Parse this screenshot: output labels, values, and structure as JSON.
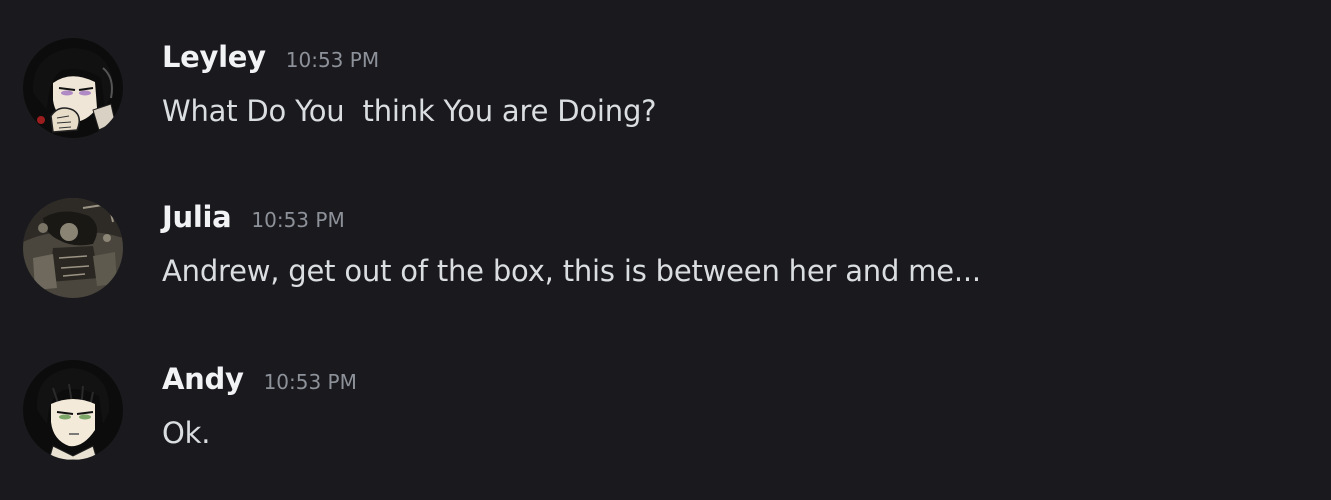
{
  "messages": [
    {
      "username": "Leyley",
      "timestamp": "10:53 PM",
      "content": "What Do You  think You are Doing?",
      "avatar": "leyley-avatar"
    },
    {
      "username": "Julia",
      "timestamp": "10:53 PM",
      "content": "Andrew, get out of the box, this is between her and me...",
      "avatar": "julia-avatar"
    },
    {
      "username": "Andy",
      "timestamp": "10:53 PM",
      "content": "Ok.",
      "avatar": "andy-avatar"
    }
  ],
  "colors": {
    "background": "#1a1a1e",
    "username": "#f2f3f5",
    "timestamp": "#8d9199",
    "message_text": "#dbdee1"
  }
}
